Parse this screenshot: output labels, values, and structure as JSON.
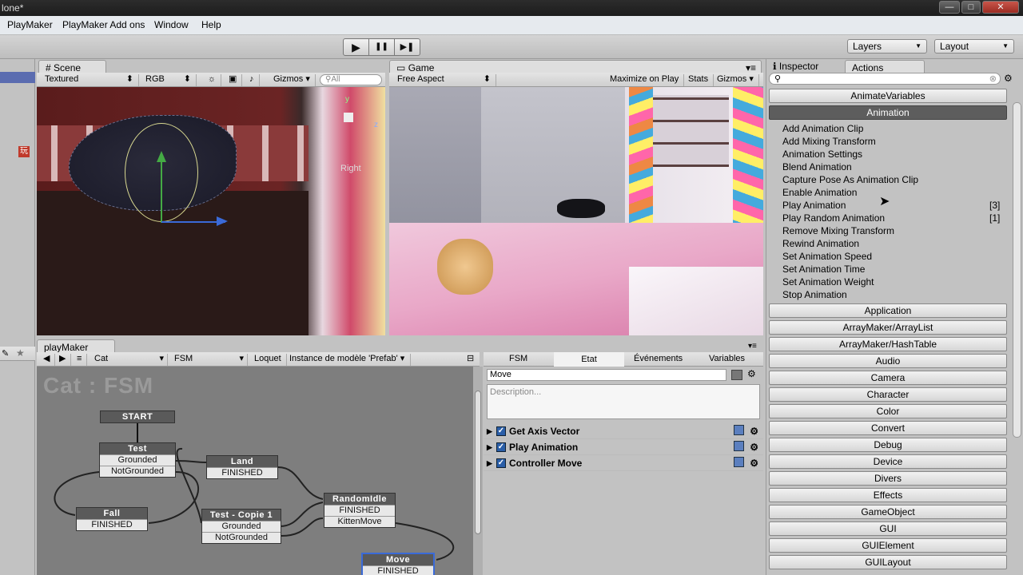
{
  "window": {
    "title": "lone*",
    "min": "—",
    "max": "□",
    "close": "✕"
  },
  "menu": [
    "PlayMaker",
    "PlayMaker Add ons",
    "Window",
    "Help"
  ],
  "toolbar": {
    "play": "▶",
    "pause": "❚❚",
    "step": "▶❚",
    "layers": "Layers",
    "layout": "Layout"
  },
  "scene": {
    "tab": "Scene",
    "shading": "Textured",
    "mode": "RGB",
    "gizmos": "Gizmos",
    "search": "All",
    "axis_label": "Right",
    "axis_y": "y",
    "axis_z": "z"
  },
  "game": {
    "tab": "Game",
    "aspect": "Free Aspect",
    "maximize": "Maximize on Play",
    "stats": "Stats",
    "gizmos": "Gizmos"
  },
  "hierarchy": {
    "icon": "玩"
  },
  "playmaker": {
    "tab": "playMaker",
    "object": "Cat",
    "fsm": "FSM",
    "lock": "Loquet",
    "prefab": "Instance de modèle 'Prefab'",
    "graph_title": "Cat : FSM",
    "nodes": {
      "start": "START",
      "test": "Test",
      "grounded": "Grounded",
      "notgrounded": "NotGrounded",
      "land": "Land",
      "finished": "FINISHED",
      "fall": "Fall",
      "copie": "Test - Copie 1",
      "randomidle": "RandomIdle",
      "kittenmove": "KittenMove",
      "move": "Move"
    }
  },
  "state": {
    "tabs": [
      "FSM",
      "Etat",
      "Événements",
      "Variables"
    ],
    "name": "Move",
    "description": "Description...",
    "actions": [
      "Get Axis Vector",
      "Play Animation",
      "Controller Move"
    ]
  },
  "right": {
    "inspector_tab": "Inspector",
    "actions_tab": "Actions",
    "search": "",
    "categories_top": [
      "AnimateVariables",
      "Animation"
    ],
    "animation_items": [
      "Add Animation Clip",
      "Add Mixing Transform",
      "Animation Settings",
      "Blend Animation",
      "Capture Pose As Animation Clip",
      "Enable Animation",
      "Play Animation",
      "Play Random Animation",
      "Remove Mixing Transform",
      "Rewind Animation",
      "Set Animation Speed",
      "Set Animation Time",
      "Set Animation Weight",
      "Stop Animation"
    ],
    "counts": {
      "play": "[3]",
      "random": "[1]"
    },
    "categories": [
      "Application",
      "ArrayMaker/ArrayList",
      "ArrayMaker/HashTable",
      "Audio",
      "Camera",
      "Character",
      "Color",
      "Convert",
      "Debug",
      "Device",
      "Divers",
      "Effects",
      "GameObject",
      "GUI",
      "GUIElement",
      "GUILayout"
    ]
  }
}
